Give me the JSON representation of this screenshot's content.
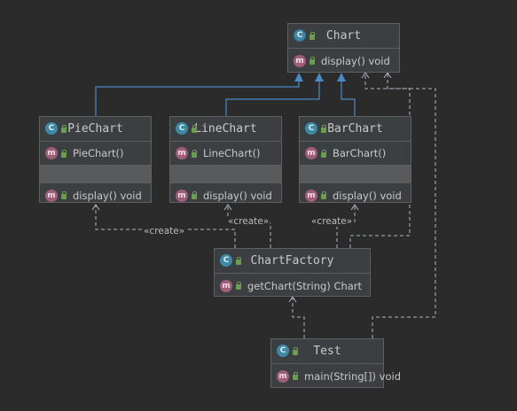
{
  "classes": {
    "chart": {
      "name": "Chart",
      "methods": [
        {
          "name": "display()",
          "type": "void"
        }
      ]
    },
    "pie_chart": {
      "name": "PieChart",
      "constructor": "PieChart()",
      "methods": [
        {
          "name": "display()",
          "type": "void"
        }
      ]
    },
    "line_chart": {
      "name": "LineChart",
      "constructor": "LineChart()",
      "methods": [
        {
          "name": "display()",
          "type": "void"
        }
      ]
    },
    "bar_chart": {
      "name": "BarChart",
      "constructor": "BarChart()",
      "methods": [
        {
          "name": "display()",
          "type": "void"
        }
      ]
    },
    "chart_factory": {
      "name": "ChartFactory",
      "methods": [
        {
          "name": "getChart(String)",
          "type": "Chart"
        }
      ]
    },
    "test": {
      "name": "Test",
      "methods": [
        {
          "name": "main(String[])",
          "type": "void"
        }
      ]
    }
  },
  "labels": {
    "create": "«create»"
  },
  "icons": {
    "class": "c-icon",
    "method": "m-icon",
    "visibility": "lock-icon"
  },
  "colors": {
    "background": "#2b2b2b",
    "node": "#3c3f41",
    "inheritance": "#4a88c7",
    "dependency": "#a9b7c6"
  }
}
